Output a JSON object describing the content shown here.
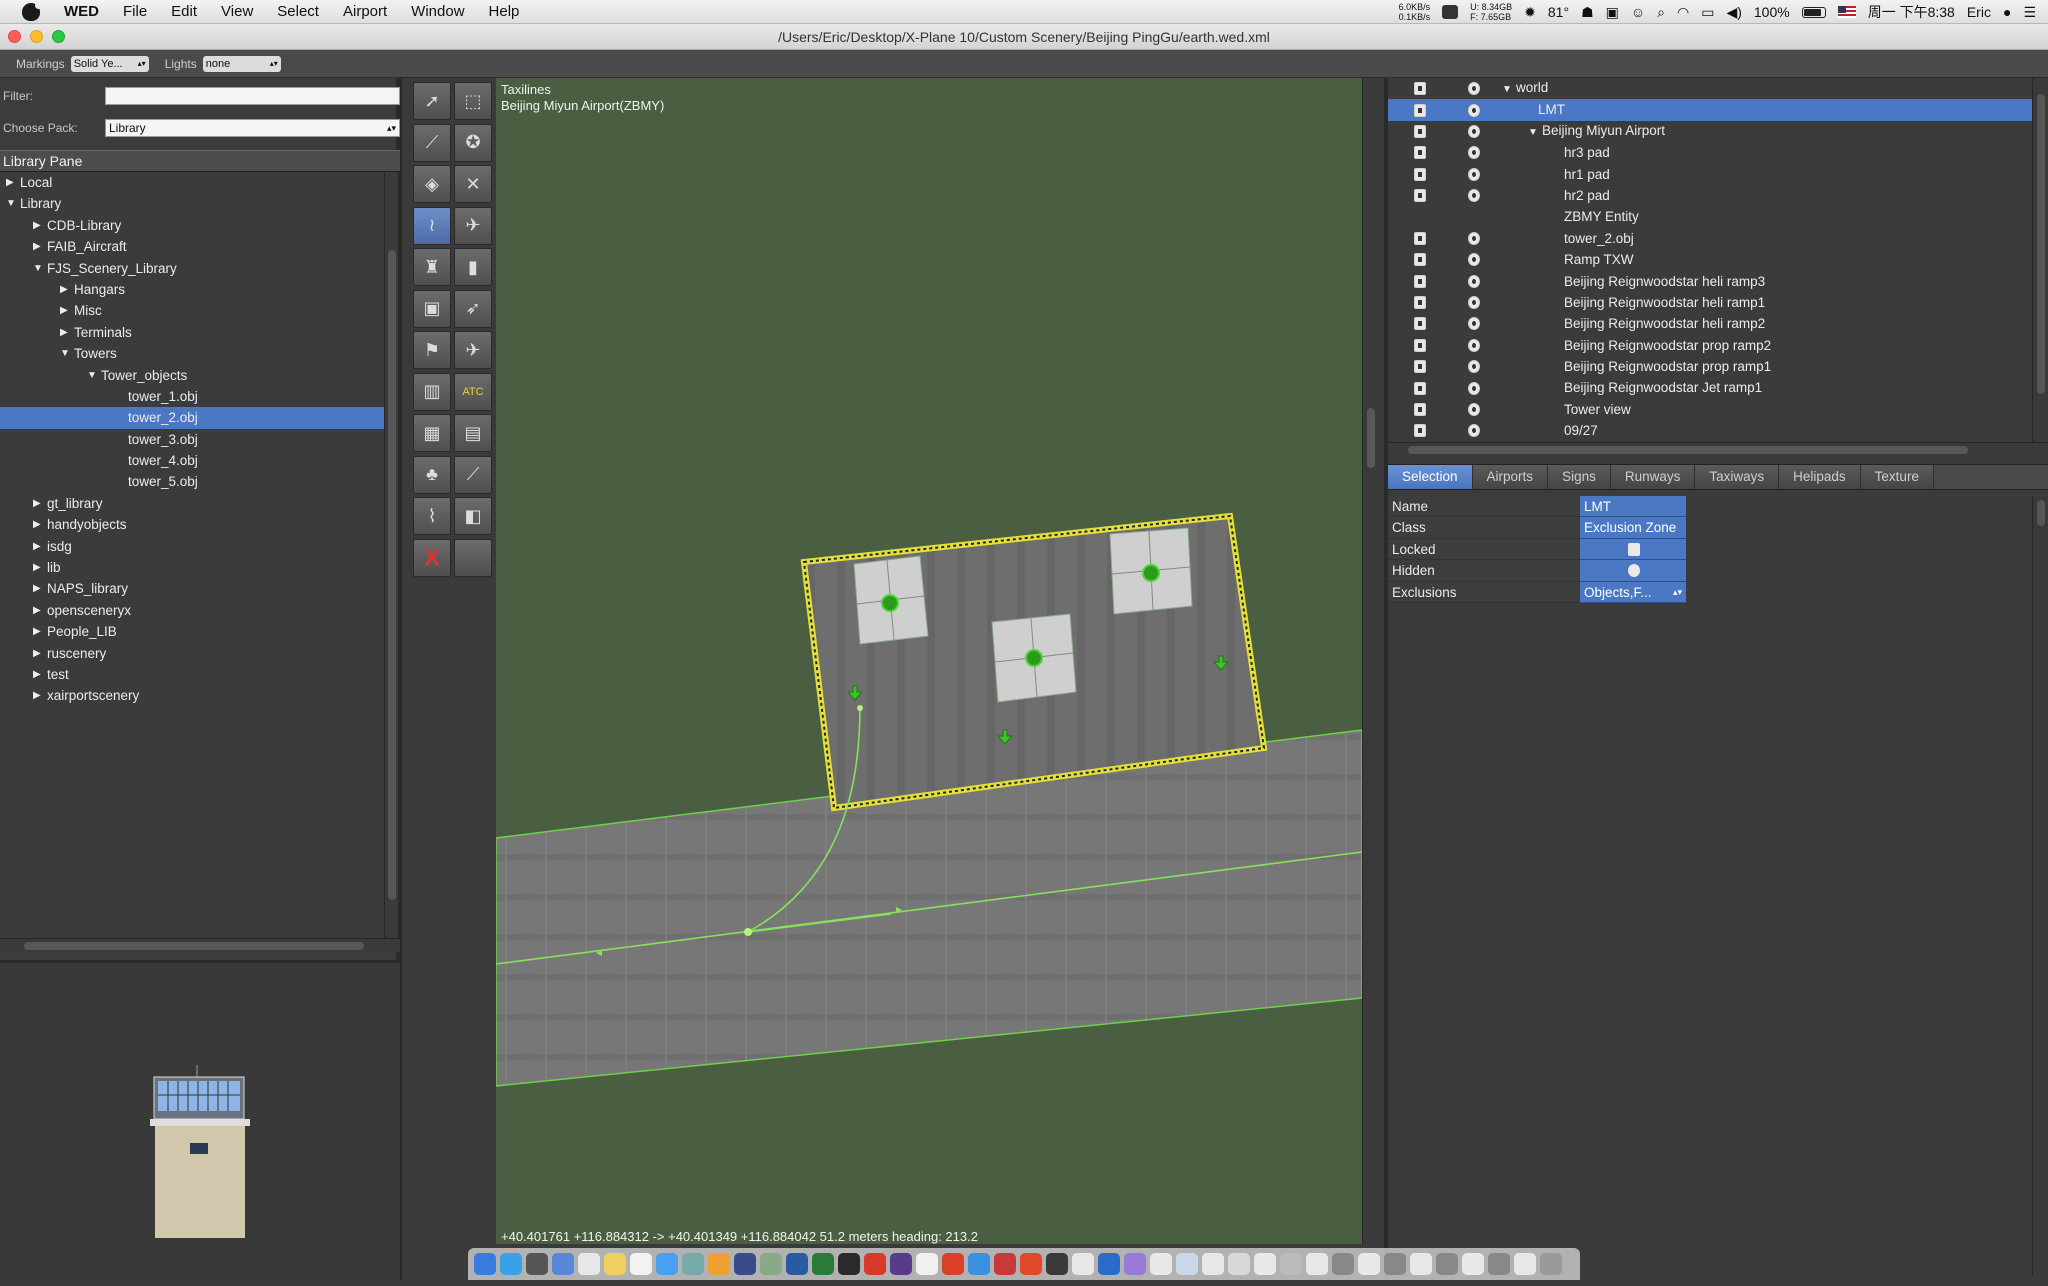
{
  "menubar": {
    "app_name": "WED",
    "menus": [
      "File",
      "Edit",
      "View",
      "Select",
      "Airport",
      "Window",
      "Help"
    ],
    "net_up": "6.0KB/s",
    "net_down": "0.1KB/s",
    "disk_u": "8.34GB",
    "disk_f": "7.65GB",
    "disk_u_label": "U:",
    "disk_f_label": "F:",
    "temperature": "81°",
    "battery_pct": "100%",
    "datetime": "周一 下午8:38",
    "user": "Eric"
  },
  "window": {
    "title": "/Users/Eric/Desktop/X-Plane 10/Custom Scenery/Beijing PingGu/earth.wed.xml"
  },
  "toolbar": {
    "markings_label": "Markings",
    "markings_value": "Solid Ye...",
    "lights_label": "Lights",
    "lights_value": "none"
  },
  "library": {
    "filter_label": "Filter:",
    "filter_value": "",
    "pack_label": "Choose Pack:",
    "pack_value": "Library",
    "pane_title": "Library Pane",
    "tree": [
      {
        "label": "Local",
        "indent": 0,
        "state": "closed"
      },
      {
        "label": "Library",
        "indent": 0,
        "state": "open"
      },
      {
        "label": "CDB-Library",
        "indent": 1,
        "state": "closed"
      },
      {
        "label": "FAIB_Aircraft",
        "indent": 1,
        "state": "closed"
      },
      {
        "label": "FJS_Scenery_Library",
        "indent": 1,
        "state": "open"
      },
      {
        "label": "Hangars",
        "indent": 2,
        "state": "closed"
      },
      {
        "label": "Misc",
        "indent": 2,
        "state": "closed"
      },
      {
        "label": "Terminals",
        "indent": 2,
        "state": "closed"
      },
      {
        "label": "Towers",
        "indent": 2,
        "state": "open"
      },
      {
        "label": "Tower_objects",
        "indent": 3,
        "state": "open"
      },
      {
        "label": "tower_1.obj",
        "indent": 4,
        "state": "leaf"
      },
      {
        "label": "tower_2.obj",
        "indent": 4,
        "state": "leaf",
        "selected": true
      },
      {
        "label": "tower_3.obj",
        "indent": 4,
        "state": "leaf"
      },
      {
        "label": "tower_4.obj",
        "indent": 4,
        "state": "leaf"
      },
      {
        "label": "tower_5.obj",
        "indent": 4,
        "state": "leaf"
      },
      {
        "label": "gt_library",
        "indent": 1,
        "state": "closed"
      },
      {
        "label": "handyobjects",
        "indent": 1,
        "state": "closed"
      },
      {
        "label": "isdg",
        "indent": 1,
        "state": "closed"
      },
      {
        "label": "lib",
        "indent": 1,
        "state": "closed"
      },
      {
        "label": "NAPS_library",
        "indent": 1,
        "state": "closed"
      },
      {
        "label": "opensceneryx",
        "indent": 1,
        "state": "closed"
      },
      {
        "label": "People_LIB",
        "indent": 1,
        "state": "closed"
      },
      {
        "label": "ruscenery",
        "indent": 1,
        "state": "closed"
      },
      {
        "label": "test",
        "indent": 1,
        "state": "closed"
      },
      {
        "label": "xairportscenery",
        "indent": 1,
        "state": "closed"
      }
    ]
  },
  "tools": [
    {
      "icon": "vertex-select-arrow-icon",
      "glyph": "➚",
      "active": false
    },
    {
      "icon": "marquee-select-icon",
      "glyph": "⬚",
      "active": false
    },
    {
      "icon": "runway-tool-icon",
      "glyph": "⟋",
      "active": false
    },
    {
      "icon": "helipad-tool-icon",
      "glyph": "✪",
      "active": false
    },
    {
      "icon": "sealane-tool-icon",
      "glyph": "◈",
      "active": false
    },
    {
      "icon": "boundary-tool-icon",
      "glyph": "✕",
      "active": false
    },
    {
      "icon": "taxiline-tool-icon",
      "glyph": "≀",
      "active": true
    },
    {
      "icon": "ramp-start-tool-icon",
      "glyph": "✈",
      "active": false
    },
    {
      "icon": "tower-viewpoint-tool-icon",
      "glyph": "♜",
      "active": false
    },
    {
      "icon": "sign-tool-icon",
      "glyph": "▮",
      "active": false
    },
    {
      "icon": "object-tool-icon",
      "glyph": "▣",
      "active": false
    },
    {
      "icon": "windsock-tool-icon",
      "glyph": "➶",
      "active": false
    },
    {
      "icon": "light-fixture-tool-icon",
      "glyph": "⚑",
      "active": false
    },
    {
      "icon": "aircraft-tool-icon",
      "glyph": "✈",
      "active": false
    },
    {
      "icon": "facade-tool-icon",
      "glyph": "▥",
      "active": false
    },
    {
      "icon": "atc-frequency-tool-icon",
      "glyph": "ATC",
      "active": false
    },
    {
      "icon": "building-tool-icon",
      "glyph": "▦",
      "active": false
    },
    {
      "icon": "forest-line-tool-icon",
      "glyph": "▤",
      "active": false
    },
    {
      "icon": "tree-tool-icon",
      "glyph": "♣",
      "active": false
    },
    {
      "icon": "line-tool-icon",
      "glyph": "⟋",
      "active": false
    },
    {
      "icon": "string-tool-icon",
      "glyph": "⌇",
      "active": false
    },
    {
      "icon": "polygon-tool-icon",
      "glyph": "◧",
      "active": false
    },
    {
      "icon": "exclusion-tool-icon",
      "glyph": "X",
      "active": false
    },
    {
      "icon": "empty-tool-icon",
      "glyph": "",
      "active": false
    }
  ],
  "map": {
    "layer_name": "Taxilines",
    "airport_name": "Beijing Miyun Airport(ZBMY)",
    "status_text": "+40.401761 +116.884312 -> +40.401349 +116.884042 51.2 meters heading: 213.2"
  },
  "hierarchy": [
    {
      "label": "world",
      "indent": 0,
      "state": "open",
      "lock": true,
      "eye": true
    },
    {
      "label": "LMT",
      "indent": 1,
      "state": "leaf",
      "lock": true,
      "eye": true,
      "selected": true
    },
    {
      "label": "Beijing Miyun Airport",
      "indent": 1,
      "state": "open",
      "lock": true,
      "eye": true
    },
    {
      "label": "hr3 pad",
      "indent": 2,
      "state": "leaf",
      "lock": true,
      "eye": true
    },
    {
      "label": "hr1 pad",
      "indent": 2,
      "state": "leaf",
      "lock": true,
      "eye": true
    },
    {
      "label": "hr2 pad",
      "indent": 2,
      "state": "leaf",
      "lock": true,
      "eye": true
    },
    {
      "label": "ZBMY Entity",
      "indent": 2,
      "state": "leaf",
      "lock": false,
      "eye": false
    },
    {
      "label": "tower_2.obj",
      "indent": 2,
      "state": "leaf",
      "lock": true,
      "eye": true
    },
    {
      "label": "Ramp TXW",
      "indent": 2,
      "state": "leaf",
      "lock": true,
      "eye": true
    },
    {
      "label": "Beijing Reignwoodstar heli ramp3",
      "indent": 2,
      "state": "leaf",
      "lock": true,
      "eye": true
    },
    {
      "label": "Beijing Reignwoodstar heli ramp1",
      "indent": 2,
      "state": "leaf",
      "lock": true,
      "eye": true
    },
    {
      "label": "Beijing Reignwoodstar heli ramp2",
      "indent": 2,
      "state": "leaf",
      "lock": true,
      "eye": true
    },
    {
      "label": "Beijing Reignwoodstar prop ramp2",
      "indent": 2,
      "state": "leaf",
      "lock": true,
      "eye": true
    },
    {
      "label": "Beijing Reignwoodstar prop ramp1",
      "indent": 2,
      "state": "leaf",
      "lock": true,
      "eye": true
    },
    {
      "label": "Beijing Reignwoodstar Jet ramp1",
      "indent": 2,
      "state": "leaf",
      "lock": true,
      "eye": true
    },
    {
      "label": "Tower view",
      "indent": 2,
      "state": "leaf",
      "lock": true,
      "eye": true
    },
    {
      "label": "09/27",
      "indent": 2,
      "state": "leaf",
      "lock": true,
      "eye": true
    }
  ],
  "property_tabs": [
    {
      "label": "Selection",
      "active": true
    },
    {
      "label": "Airports",
      "active": false
    },
    {
      "label": "Signs",
      "active": false
    },
    {
      "label": "Runways",
      "active": false
    },
    {
      "label": "Taxiways",
      "active": false
    },
    {
      "label": "Helipads",
      "active": false
    },
    {
      "label": "Texture",
      "active": false
    }
  ],
  "properties": [
    {
      "key": "Name",
      "value": "LMT",
      "kind": "text"
    },
    {
      "key": "Class",
      "value": "Exclusion Zone",
      "kind": "text"
    },
    {
      "key": "Locked",
      "value": "",
      "kind": "lock"
    },
    {
      "key": "Hidden",
      "value": "",
      "kind": "eye"
    },
    {
      "key": "Exclusions",
      "value": "Objects,F...",
      "kind": "select"
    }
  ],
  "colors": {
    "selection_blue": "#4a78c4",
    "map_grass": "#4a5f41",
    "asphalt": "#777777",
    "taxiline_green": "#7fe05a",
    "exclusion_yellow": "#d8d43a"
  }
}
